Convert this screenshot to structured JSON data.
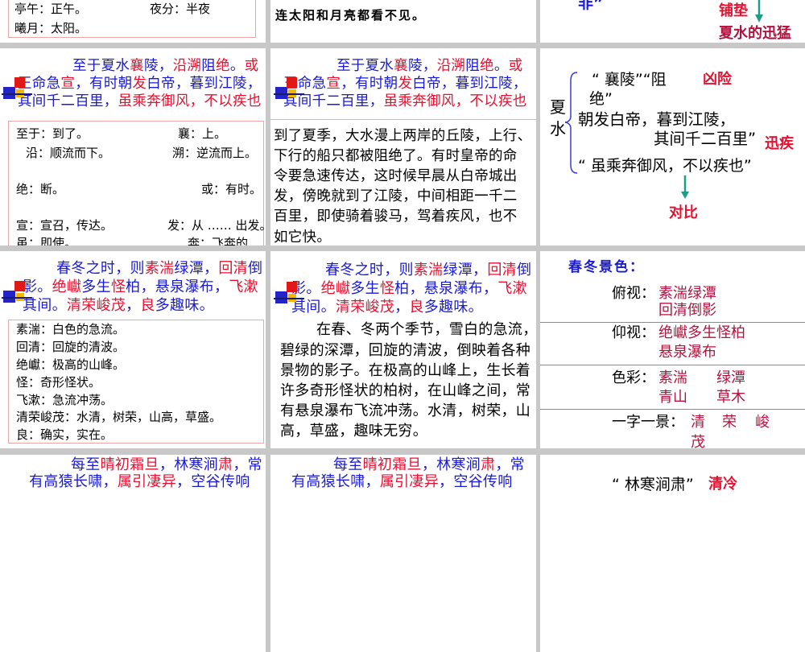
{
  "palette": {
    "background": "#c8c8c8",
    "slide": "#ffffff",
    "blue": "#1a1ad4",
    "red": "#e61030",
    "maroon": "#b3123e",
    "black": "#000000",
    "teal": "#1e9c8a",
    "box_border": "#e9a7a7",
    "brace": "#3b3bd0",
    "rule": "#8c8c8c",
    "deco_blue": "#2323c8",
    "deco_red": "#e01818",
    "deco_yellow": "#f2b800"
  },
  "row1": {
    "slide1": {
      "gloss": [
        "亭午：正午。",
        "夜分：半夜",
        "曦月：太阳。"
      ]
    },
    "slide2": {
      "translation_tail": "连太阳和月亮都看不见。"
    },
    "slide3": {
      "quote_tail": "非”",
      "note_top": "铺垫",
      "note_bottom": "夏水的迅猛"
    }
  },
  "row2": {
    "passage_lines": [
      [
        {
          "t": "至于夏水",
          "c": "blue"
        },
        {
          "t": "襄",
          "c": "red"
        },
        {
          "t": "陵，",
          "c": "blue"
        },
        {
          "t": "沿溯",
          "c": "red"
        },
        {
          "t": "阻",
          "c": "blue"
        },
        {
          "t": "绝",
          "c": "red"
        },
        {
          "t": "。",
          "c": "blue"
        },
        {
          "t": "或",
          "c": "red"
        }
      ],
      [
        {
          "t": "王命急",
          "c": "blue"
        },
        {
          "t": "宣",
          "c": "red"
        },
        {
          "t": "，有时朝",
          "c": "blue"
        },
        {
          "t": "发",
          "c": "red"
        },
        {
          "t": "白帝，暮到江陵，",
          "c": "blue"
        }
      ],
      [
        {
          "t": "其间千二百里，",
          "c": "blue"
        },
        {
          "t": "虽乘奔御风，不以疾也",
          "c": "red"
        }
      ]
    ],
    "gloss": [
      "至于：到了。",
      "襄：上。",
      "沿：顺流而下。",
      "溯：逆流而上。",
      "绝：断。",
      "或：有时。",
      "宣：宣召，传达。",
      "发：从 …… 出发。",
      "虽：即使。",
      "奔：飞奔的"
    ],
    "translation_lines": [
      "到了夏季，大水漫上两岸的丘陵，上行、",
      "下行的船只都被阻绝了。有时皇帝的命",
      "令要急速传达，这时候早晨从白帝城出",
      "发，傍晚就到了江陵，中间相距一千二",
      "百里，即使骑着骏马，驾着疾风，也不",
      "如它快。"
    ],
    "analysis": {
      "topic_char_1": "夏",
      "topic_char_2": "水",
      "line_xiangling": "“ 襄陵”“阻",
      "tag_xiongxian": "凶险",
      "line_jue": "绝”",
      "line_chaofa": "朝发白帝，暮到江陵，",
      "line_qijian": "其间千二百里”",
      "tag_xunji": "迅疾",
      "line_sui": "“ 虽乘奔御风，不以疾也”",
      "tag_duibi": "对比"
    }
  },
  "row3": {
    "passage_lines": [
      [
        {
          "t": "春冬之时，则",
          "c": "blue"
        },
        {
          "t": "素湍",
          "c": "red"
        },
        {
          "t": "绿潭，",
          "c": "blue"
        },
        {
          "t": "回清",
          "c": "red"
        },
        {
          "t": "倒",
          "c": "blue"
        }
      ],
      [
        {
          "t": "影。",
          "c": "blue"
        },
        {
          "t": "绝巘",
          "c": "red"
        },
        {
          "t": "多生",
          "c": "blue"
        },
        {
          "t": "怪",
          "c": "red"
        },
        {
          "t": "柏，悬泉瀑布，",
          "c": "blue"
        },
        {
          "t": "飞漱",
          "c": "red"
        }
      ],
      [
        {
          "t": "其间。",
          "c": "blue"
        },
        {
          "t": "清荣峻茂",
          "c": "red"
        },
        {
          "t": "，",
          "c": "blue"
        },
        {
          "t": "良",
          "c": "red"
        },
        {
          "t": "多趣味。",
          "c": "blue"
        }
      ]
    ],
    "gloss": [
      "素湍：白色的急流。",
      "回清：回旋的清波。",
      "绝巘：极高的山峰。",
      "怪：奇形怪状。",
      "飞漱：急流冲荡。",
      "清荣峻茂：水清，树荣，山高，草盛。",
      "良：确实，实在。"
    ],
    "translation_lines": [
      "在春、冬两个季节，雪白的急流，",
      "碧绿的深潭，回旋的清波，倒映着各种",
      "景物的影子。在极高的山峰上，生长着",
      "许多奇形怪状的柏树，在山峰之间，常",
      "有悬泉瀑布飞流冲荡。水清，树荣，山",
      "高，草盛，趣味无穷。"
    ],
    "scenery": {
      "title": "春冬景色：",
      "look_down": {
        "label": "俯视：",
        "values": [
          "素湍绿潭",
          "回清倒影"
        ]
      },
      "look_up": {
        "label": "仰视：",
        "values": [
          "绝巘多生怪柏",
          "悬泉瀑布"
        ]
      },
      "colors": {
        "label": "色彩：",
        "values": [
          "素湍",
          "绿潭",
          "青山",
          "草木"
        ]
      },
      "one_word": {
        "label": "一字一景：",
        "values": [
          "清",
          "荣",
          "峻",
          "茂"
        ]
      }
    }
  },
  "row4": {
    "passage_lines": [
      [
        {
          "t": "每至",
          "c": "blue"
        },
        {
          "t": "晴初霜旦",
          "c": "red"
        },
        {
          "t": "，林寒涧",
          "c": "blue"
        },
        {
          "t": "肃",
          "c": "red"
        },
        {
          "t": "，常",
          "c": "blue"
        }
      ],
      [
        {
          "t": "有高猿长啸，",
          "c": "blue"
        },
        {
          "t": "属引凄异",
          "c": "red"
        },
        {
          "t": "，空谷传响",
          "c": "blue"
        }
      ]
    ],
    "analysis": {
      "quote": "“ 林寒涧肃”",
      "tag": "清冷"
    }
  }
}
